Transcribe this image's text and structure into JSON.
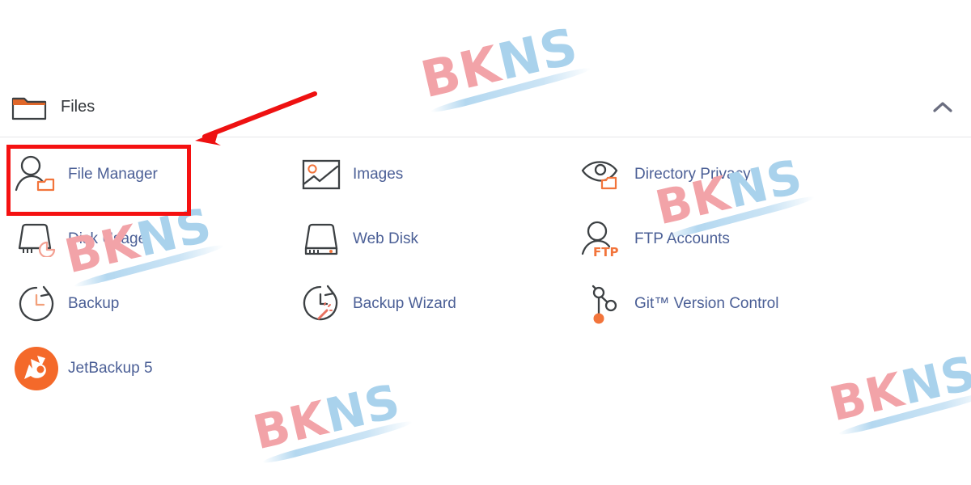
{
  "panel": {
    "title": "Files",
    "icon": "folder-icon",
    "collapse_icon": "chevron-up-icon",
    "collapsed": false
  },
  "items": [
    {
      "label": "File Manager",
      "icon": "file-manager-icon",
      "highlighted": true
    },
    {
      "label": "Images",
      "icon": "images-icon",
      "highlighted": false
    },
    {
      "label": "Directory Privacy",
      "icon": "directory-privacy-icon",
      "highlighted": false
    },
    {
      "label": "Disk Usage",
      "icon": "disk-usage-icon",
      "highlighted": false
    },
    {
      "label": "Web Disk",
      "icon": "web-disk-icon",
      "highlighted": false
    },
    {
      "label": "FTP Accounts",
      "icon": "ftp-accounts-icon",
      "highlighted": false
    },
    {
      "label": "Backup",
      "icon": "backup-icon",
      "highlighted": false
    },
    {
      "label": "Backup Wizard",
      "icon": "backup-wizard-icon",
      "highlighted": false
    },
    {
      "label": "Git™ Version Control",
      "icon": "git-version-control-icon",
      "highlighted": false
    },
    {
      "label": "JetBackup 5",
      "icon": "jetbackup-icon",
      "highlighted": false
    }
  ],
  "annotations": {
    "highlight_color": "#f51111",
    "arrow_color": "#ee1111",
    "arrow_target": "File Manager",
    "highlight_target": "File Manager"
  },
  "watermark": {
    "text": "BKNS",
    "part_one": "BK",
    "part_two": "NS",
    "color_one": "#f2a3a8",
    "color_two": "#a9d2ec"
  },
  "colors": {
    "link_text": "#4b5f96",
    "title_text": "#33373b",
    "icon_stroke": "#3c4043",
    "icon_accent": "#f2743b",
    "divider": "#e7e7e9",
    "background": "#ffffff"
  }
}
